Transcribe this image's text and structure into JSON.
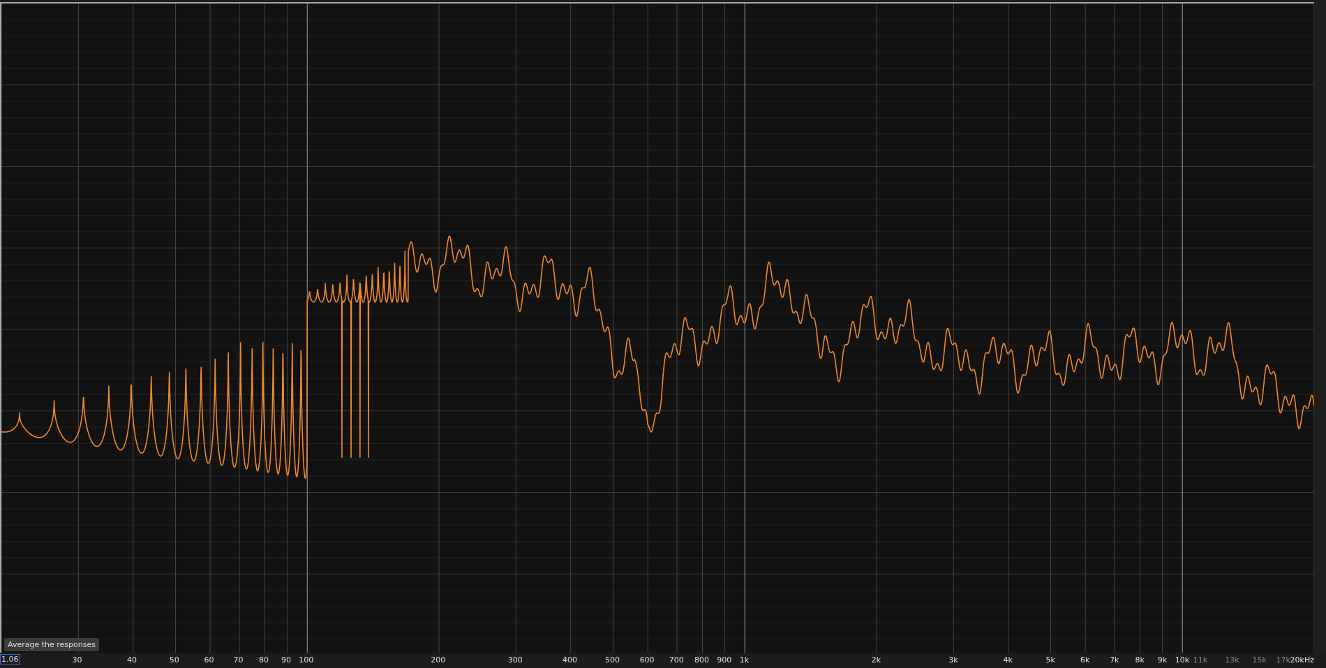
{
  "plot": {
    "x_axis_labels": [
      {
        "label": "30",
        "dim": false
      },
      {
        "label": "40",
        "dim": false
      },
      {
        "label": "50",
        "dim": false
      },
      {
        "label": "60",
        "dim": false
      },
      {
        "label": "70",
        "dim": false
      },
      {
        "label": "80",
        "dim": false
      },
      {
        "label": "90",
        "dim": false
      },
      {
        "label": "100",
        "dim": false
      },
      {
        "label": "200",
        "dim": false
      },
      {
        "label": "300",
        "dim": false
      },
      {
        "label": "400",
        "dim": false
      },
      {
        "label": "500",
        "dim": false
      },
      {
        "label": "600",
        "dim": false
      },
      {
        "label": "700",
        "dim": false
      },
      {
        "label": "800",
        "dim": false
      },
      {
        "label": "900",
        "dim": false
      },
      {
        "label": "1k",
        "dim": false
      },
      {
        "label": "2k",
        "dim": false
      },
      {
        "label": "3k",
        "dim": false
      },
      {
        "label": "4k",
        "dim": false
      },
      {
        "label": "5k",
        "dim": false
      },
      {
        "label": "6k",
        "dim": false
      },
      {
        "label": "7k",
        "dim": false
      },
      {
        "label": "8k",
        "dim": false
      },
      {
        "label": "9k",
        "dim": false
      },
      {
        "label": "10k",
        "dim": false
      },
      {
        "label": "11k",
        "dim": true
      },
      {
        "label": "13k",
        "dim": true
      },
      {
        "label": "15k",
        "dim": true
      },
      {
        "label": "17k",
        "dim": true
      },
      {
        "label": "20kHz",
        "dim": false
      }
    ]
  },
  "cursor_readout": "1.06",
  "tooltip": "Average the responses"
}
